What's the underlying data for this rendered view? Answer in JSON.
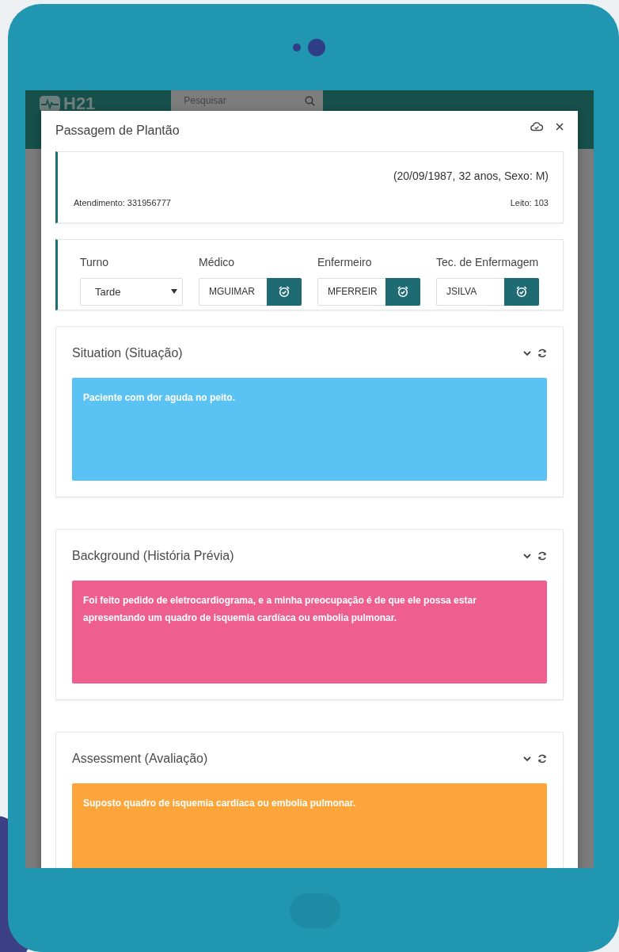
{
  "app_header": {
    "logo": "H21",
    "search": {
      "placeholder": "Pesquisar"
    }
  },
  "modal": {
    "title": "Passagem de Plantão",
    "patient": {
      "details": "(20/09/1987, 32 anos, Sexo: M)",
      "attendance_label": "Atendimento:",
      "attendance": "331956777",
      "bed_label": "Leito:",
      "bed": "103"
    },
    "staff": [
      {
        "kind": "select",
        "label": "Turno",
        "value": "Tarde"
      },
      {
        "kind": "input",
        "label": "Médico",
        "value": "MGUIMAR"
      },
      {
        "kind": "input",
        "label": "Enfermeiro",
        "value": "MFERREIR"
      },
      {
        "kind": "input",
        "label": "Tec. de Enfermagem",
        "value": "JSILVA"
      }
    ],
    "sections": [
      {
        "title": "Situation (Situação)",
        "text": "Paciente com dor aguda no peito.",
        "color": "#5ac3f3"
      },
      {
        "title": "Background (História Prévia)",
        "text": "Foi feito pedido de eletrocardiograma, e a minha preocupação é de que ele possa estar apresentando um quadro de isquemia cardíaca ou embolia pulmonar.",
        "color": "#ee5f8f"
      },
      {
        "title": "Assessment (Avaliação)",
        "text": "Suposto quadro de isquemia cardíaca ou embolia pulmonar.",
        "color": "#fba53a"
      }
    ]
  }
}
